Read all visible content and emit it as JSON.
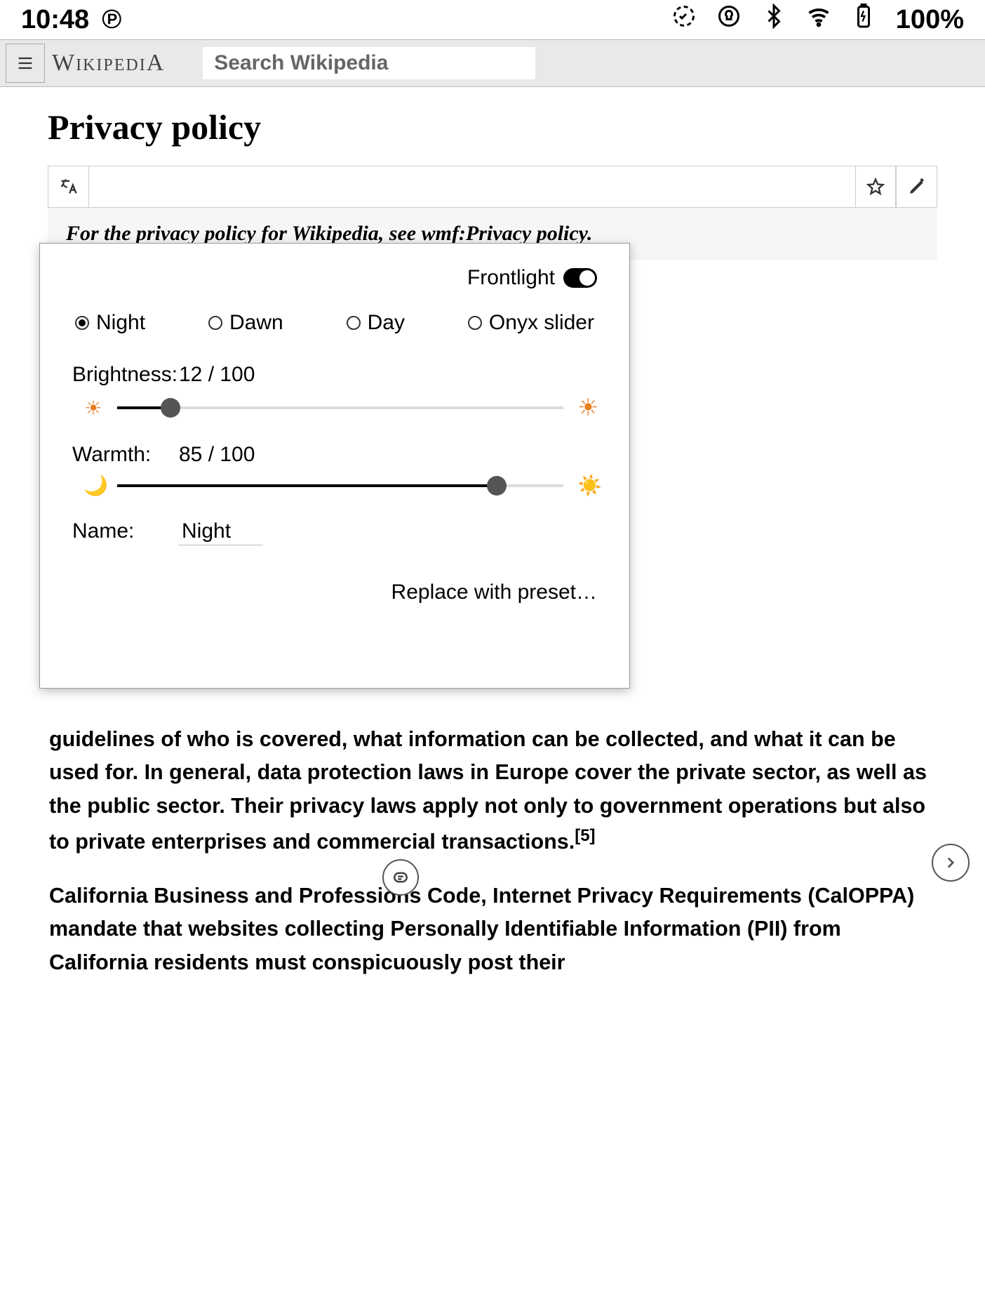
{
  "status": {
    "time": "10:48",
    "battery": "100%"
  },
  "header": {
    "wordmark": "WikipediA",
    "search_placeholder": "Search Wikipedia"
  },
  "page": {
    "title": "Privacy policy",
    "hatnote_prefix": "For the privacy policy for Wikipedia, see ",
    "hatnote_link": "wmf:Privacy policy",
    "hatnote_suffix": ".",
    "body1a": "guidelines of who is covered, what information can be collected, and what it can be used for. In general, data protection laws in Europe cover the private sector, as well as the public sector. Their privacy laws apply not only to government operations but also to private enterprises and commercial transactions.",
    "ref1": "[5]",
    "body2": "California Business and Professions Code, Internet Privacy Requirements (CalOPPA) mandate that websites collecting Personally Identifiable Information (PII) from California residents must conspicuously post their"
  },
  "modal": {
    "frontlight_label": "Frontlight",
    "frontlight_on": true,
    "presets": [
      "Night",
      "Dawn",
      "Day",
      "Onyx slider"
    ],
    "selected_preset": "Night",
    "brightness_label": "Brightness:",
    "brightness_value": "12 / 100",
    "brightness_pct": 12,
    "warmth_label": "Warmth:",
    "warmth_value": "85 / 100",
    "warmth_pct": 85,
    "name_label": "Name:",
    "name_value": "Night",
    "replace_label": "Replace with preset…"
  }
}
